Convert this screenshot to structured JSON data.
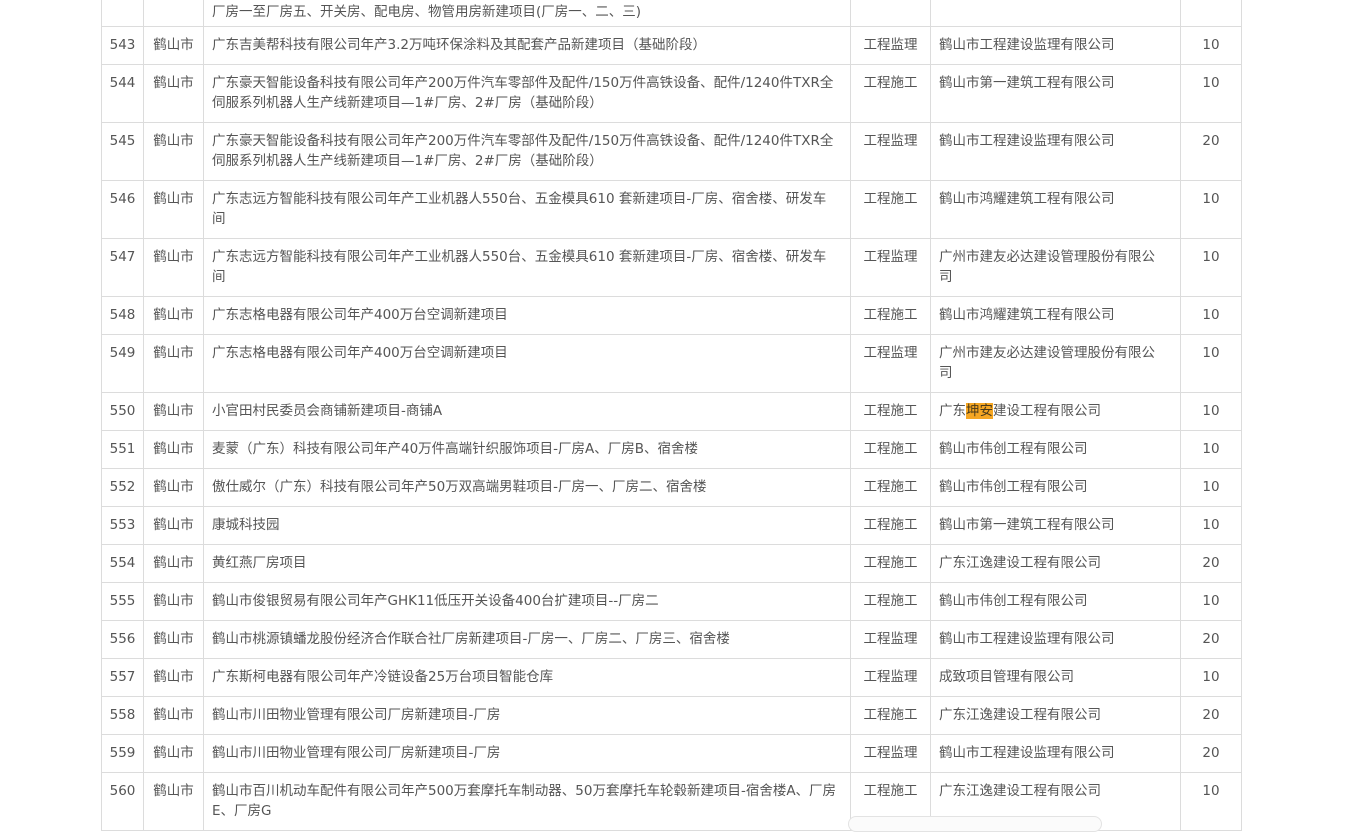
{
  "top_row": {
    "project": "楼、配电房新建项目(厂房一、厂房八); 鹤山市址山镇四九村禾房股份经济合作社鹤山市厨卫五金工业园厂房一至厂房五、开关房、配电房、物管用房新建项目(厂房一、二、三)"
  },
  "rows": [
    {
      "no": "543",
      "city": "鹤山市",
      "project": "广东吉美帮科技有限公司年产3.2万吨环保涂料及其配套产品新建项目（基础阶段）",
      "type": "工程监理",
      "company": "鹤山市工程建设监理有限公司",
      "score": "10"
    },
    {
      "no": "544",
      "city": "鹤山市",
      "project": "广东豪天智能设备科技有限公司年产200万件汽车零部件及配件/150万件高铁设备、配件/1240件TXR全伺服系列机器人生产线新建项目—1#厂房、2#厂房（基础阶段）",
      "type": "工程施工",
      "company": "鹤山市第一建筑工程有限公司",
      "score": "10"
    },
    {
      "no": "545",
      "city": "鹤山市",
      "project": "广东豪天智能设备科技有限公司年产200万件汽车零部件及配件/150万件高铁设备、配件/1240件TXR全伺服系列机器人生产线新建项目—1#厂房、2#厂房（基础阶段）",
      "type": "工程监理",
      "company": "鹤山市工程建设监理有限公司",
      "score": "20"
    },
    {
      "no": "546",
      "city": "鹤山市",
      "project": "广东志远方智能科技有限公司年产工业机器人550台、五金模具610 套新建项目-厂房、宿舍楼、研发车间",
      "type": "工程施工",
      "company": "鹤山市鸿耀建筑工程有限公司",
      "score": "10"
    },
    {
      "no": "547",
      "city": "鹤山市",
      "project": "广东志远方智能科技有限公司年产工业机器人550台、五金模具610 套新建项目-厂房、宿舍楼、研发车间",
      "type": "工程监理",
      "company": "广州市建友必达建设管理股份有限公司",
      "score": "10"
    },
    {
      "no": "548",
      "city": "鹤山市",
      "project": "广东志格电器有限公司年产400万台空调新建项目",
      "type": "工程施工",
      "company": "鹤山市鸿耀建筑工程有限公司",
      "score": "10"
    },
    {
      "no": "549",
      "city": "鹤山市",
      "project": "广东志格电器有限公司年产400万台空调新建项目",
      "type": "工程监理",
      "company": "广州市建友必达建设管理股份有限公司",
      "score": "10"
    },
    {
      "no": "550",
      "city": "鹤山市",
      "project": "小官田村民委员会商铺新建项目-商铺A",
      "type": "工程施工",
      "company": "广东坤安建设工程有限公司",
      "company_pre": "广东",
      "company_hl": "坤安",
      "company_post": "建设工程有限公司",
      "score": "10"
    },
    {
      "no": "551",
      "city": "鹤山市",
      "project": "麦蒙（广东）科技有限公司年产40万件高端针织服饰项目-厂房A、厂房B、宿舍楼",
      "type": "工程施工",
      "company": "鹤山市伟创工程有限公司",
      "score": "10"
    },
    {
      "no": "552",
      "city": "鹤山市",
      "project": "傲仕威尔（广东）科技有限公司年产50万双高端男鞋项目-厂房一、厂房二、宿舍楼",
      "type": "工程施工",
      "company": "鹤山市伟创工程有限公司",
      "score": "10"
    },
    {
      "no": "553",
      "city": "鹤山市",
      "project": "康城科技园",
      "type": "工程施工",
      "company": "鹤山市第一建筑工程有限公司",
      "score": "10"
    },
    {
      "no": "554",
      "city": "鹤山市",
      "project": "黄红燕厂房项目",
      "type": "工程施工",
      "company": "广东江逸建设工程有限公司",
      "score": "20"
    },
    {
      "no": "555",
      "city": "鹤山市",
      "project": "鹤山市俊银贸易有限公司年产GHK11低压开关设备400台扩建项目--厂房二",
      "type": "工程施工",
      "company": "鹤山市伟创工程有限公司",
      "score": "10"
    },
    {
      "no": "556",
      "city": "鹤山市",
      "project": "鹤山市桃源镇蟠龙股份经济合作联合社厂房新建项目-厂房一、厂房二、厂房三、宿舍楼",
      "type": "工程监理",
      "company": "鹤山市工程建设监理有限公司",
      "score": "20"
    },
    {
      "no": "557",
      "city": "鹤山市",
      "project": "广东斯柯电器有限公司年产冷链设备25万台项目智能仓库",
      "type": "工程监理",
      "company": "成致项目管理有限公司",
      "score": "10"
    },
    {
      "no": "558",
      "city": "鹤山市",
      "project": "鹤山市川田物业管理有限公司厂房新建项目-厂房",
      "type": "工程施工",
      "company": "广东江逸建设工程有限公司",
      "score": "20"
    },
    {
      "no": "559",
      "city": "鹤山市",
      "project": "鹤山市川田物业管理有限公司厂房新建项目-厂房",
      "type": "工程监理",
      "company": "鹤山市工程建设监理有限公司",
      "score": "20"
    },
    {
      "no": "560",
      "city": "鹤山市",
      "project": "鹤山市百川机动车配件有限公司年产500万套摩托车制动器、50万套摩托车轮毂新建项目-宿舍楼A、厂房E、厂房G",
      "type": "工程施工",
      "company": "广东江逸建设工程有限公司",
      "score": "10"
    }
  ]
}
